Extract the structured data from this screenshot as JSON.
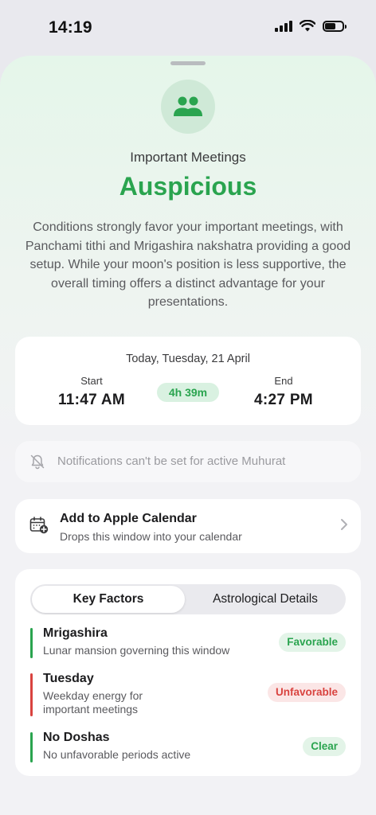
{
  "status_bar": {
    "time": "14:19"
  },
  "header": {
    "icon": "people-icon",
    "category": "Important Meetings",
    "verdict": "Auspicious",
    "summary": "Conditions strongly favor your important meetings, with Panchami tithi and Mrigashira nakshatra providing a good setup. While your moon's position is less supportive, the overall timing offers a distinct advantage for your presentations."
  },
  "window": {
    "date": "Today, Tuesday, 21 April",
    "start_label": "Start",
    "start_time": "11:47 AM",
    "duration": "4h 39m",
    "end_label": "End",
    "end_time": "4:27 PM"
  },
  "notification": {
    "icon": "bell-slash-icon",
    "text": "Notifications can't be set for active Muhurat"
  },
  "calendar": {
    "icon": "calendar-add-icon",
    "title": "Add to Apple Calendar",
    "subtitle": "Drops this window into your calendar"
  },
  "tabs": [
    {
      "label": "Key Factors",
      "active": true
    },
    {
      "label": "Astrological Details",
      "active": false
    }
  ],
  "factors": [
    {
      "name": "Mrigashira",
      "description": "Lunar mansion governing this window",
      "badge": "Favorable",
      "status": "good"
    },
    {
      "name": "Tuesday",
      "description": "Weekday energy for important meetings",
      "badge": "Unfavorable",
      "status": "bad"
    },
    {
      "name": "No Doshas",
      "description": "No unfavorable periods active",
      "badge": "Clear",
      "status": "good"
    }
  ],
  "colors": {
    "accent_green": "#2aa44f",
    "warning_red": "#d9433f"
  }
}
